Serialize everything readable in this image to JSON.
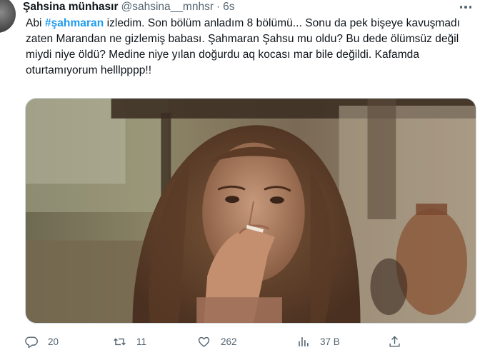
{
  "tweet": {
    "display_name": "Şahsina münhasır",
    "handle": "@sahsina__mnhsr",
    "separator": "·",
    "timestamp": "6s",
    "text_before": "Abi ",
    "hashtag": "#şahmaran",
    "text_after": " izledim. Son bölüm anladım 8 bölümü... Sonu da pek bişeye kavuşmadı zaten Marandan ne gizlemiş babası. Şahmaran Şahsu mu oldu? Bu dede ölümsüz değil miydi niye öldü? Medine niye yılan doğurdu aq kocası mar bile değildi. Kafamda oturtamıyorum helllpppp!!"
  },
  "actions": {
    "replies": "20",
    "retweets": "11",
    "likes": "262",
    "views": "37 B"
  },
  "icons": {
    "more": "more-horizontal-icon",
    "reply": "reply-bubble-icon",
    "retweet": "retweet-icon",
    "like": "heart-icon",
    "views": "views-bar-chart-icon",
    "share": "share-upload-icon"
  },
  "colors": {
    "hashtag": "#1d9bf0",
    "muted": "#536471",
    "text": "#0f1419"
  }
}
